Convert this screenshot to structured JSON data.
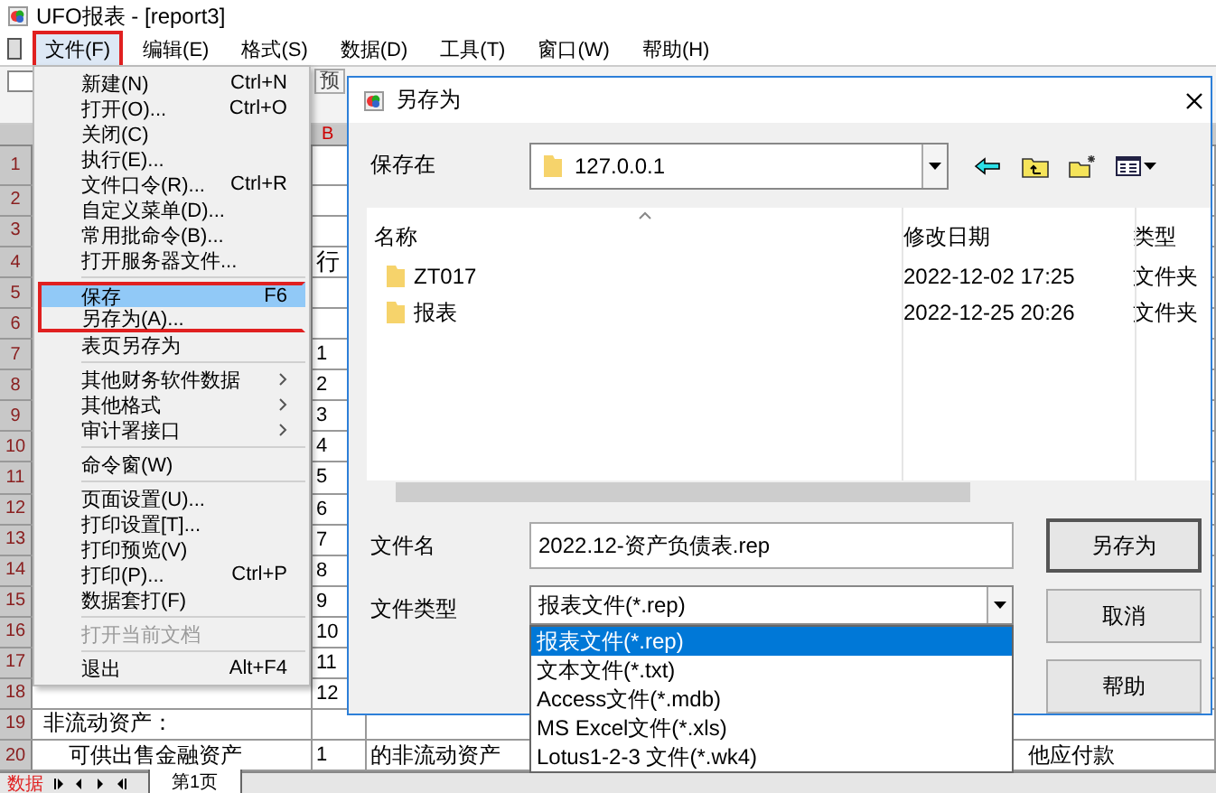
{
  "window": {
    "title": "UFO报表 - [report3]"
  },
  "menu_bar": [
    {
      "label": "文件(F)",
      "selected": true,
      "annotated": true
    },
    {
      "label": "编辑(E)",
      "selected": false,
      "annotated": false
    },
    {
      "label": "格式(S)",
      "selected": false,
      "annotated": false
    },
    {
      "label": "数据(D)",
      "selected": false,
      "annotated": false
    },
    {
      "label": "工具(T)",
      "selected": false,
      "annotated": false
    },
    {
      "label": "窗口(W)",
      "selected": false,
      "annotated": false
    },
    {
      "label": "帮助(H)",
      "selected": false,
      "annotated": false
    }
  ],
  "toolbar": {
    "button_text": "预"
  },
  "sheet": {
    "column_header": "B",
    "rows": [
      {
        "num": "1",
        "cells": []
      },
      {
        "num": "2",
        "cells": []
      },
      {
        "num": "3",
        "cells": []
      },
      {
        "num": "4",
        "cells": [
          "",
          "行"
        ]
      },
      {
        "num": "5",
        "cells": []
      },
      {
        "num": "6",
        "cells": []
      },
      {
        "num": "7",
        "cells": [
          "",
          "1"
        ]
      },
      {
        "num": "8",
        "cells": [
          "",
          "2"
        ]
      },
      {
        "num": "9",
        "cells": [
          "",
          "3"
        ]
      },
      {
        "num": "10",
        "cells": [
          "",
          "4"
        ]
      },
      {
        "num": "11",
        "cells": [
          "",
          "5"
        ]
      },
      {
        "num": "12",
        "cells": [
          "",
          "6"
        ]
      },
      {
        "num": "13",
        "cells": [
          "",
          "7"
        ]
      },
      {
        "num": "14",
        "cells": [
          "",
          "8"
        ]
      },
      {
        "num": "15",
        "cells": [
          "",
          "9"
        ]
      },
      {
        "num": "16",
        "cells": [
          "",
          "10"
        ]
      },
      {
        "num": "17",
        "cells": [
          "",
          "11"
        ]
      },
      {
        "num": "18",
        "cells": [
          "",
          "12"
        ]
      },
      {
        "num": "19",
        "cells": [
          "非流动资产："
        ]
      },
      {
        "num": "20",
        "cells": [
          "可供出售金融资产",
          "1",
          "的非流动资产",
          "他应付款"
        ]
      }
    ],
    "mode": "数据",
    "sheet_tab": "第1页"
  },
  "file_menu": [
    {
      "kind": "item",
      "label": "新建(N)",
      "shortcut": "Ctrl+N",
      "selected": false,
      "disabled": false,
      "annotated": false
    },
    {
      "kind": "item",
      "label": "打开(O)...",
      "shortcut": "Ctrl+O",
      "selected": false,
      "disabled": false,
      "annotated": false
    },
    {
      "kind": "item",
      "label": "关闭(C)",
      "selected": false,
      "disabled": false,
      "annotated": false
    },
    {
      "kind": "item",
      "label": "执行(E)...",
      "selected": false,
      "disabled": false,
      "annotated": false
    },
    {
      "kind": "item",
      "label": "文件口令(R)...",
      "shortcut": "Ctrl+R",
      "selected": false,
      "disabled": false,
      "annotated": false
    },
    {
      "kind": "item",
      "label": "自定义菜单(D)...",
      "selected": false,
      "disabled": false,
      "annotated": false
    },
    {
      "kind": "item",
      "label": "常用批命令(B)...",
      "selected": false,
      "disabled": false,
      "annotated": false
    },
    {
      "kind": "item",
      "label": "打开服务器文件...",
      "selected": false,
      "disabled": false,
      "annotated": false
    },
    {
      "kind": "separator"
    },
    {
      "kind": "item",
      "label": "保存",
      "shortcut": "F6",
      "selected": true,
      "disabled": false,
      "annotated": true
    },
    {
      "kind": "item",
      "label": "另存为(A)...",
      "selected": false,
      "disabled": false,
      "annotated": true
    },
    {
      "kind": "item",
      "label": "表页另存为",
      "selected": false,
      "disabled": false,
      "annotated": false
    },
    {
      "kind": "separator"
    },
    {
      "kind": "submenu",
      "label": "其他财务软件数据",
      "selected": false,
      "disabled": false,
      "annotated": false
    },
    {
      "kind": "submenu",
      "label": "其他格式",
      "selected": false,
      "disabled": false,
      "annotated": false
    },
    {
      "kind": "submenu",
      "label": "审计署接口",
      "selected": false,
      "disabled": false,
      "annotated": false
    },
    {
      "kind": "separator"
    },
    {
      "kind": "item",
      "label": "命令窗(W)",
      "selected": false,
      "disabled": false,
      "annotated": false
    },
    {
      "kind": "separator"
    },
    {
      "kind": "item",
      "label": "页面设置(U)...",
      "selected": false,
      "disabled": false,
      "annotated": false
    },
    {
      "kind": "item",
      "label": "打印设置[T]...",
      "selected": false,
      "disabled": false,
      "annotated": false
    },
    {
      "kind": "item",
      "label": "打印预览(V)",
      "selected": false,
      "disabled": false,
      "annotated": false
    },
    {
      "kind": "item",
      "label": "打印(P)...",
      "shortcut": "Ctrl+P",
      "selected": false,
      "disabled": false,
      "annotated": false
    },
    {
      "kind": "item",
      "label": "数据套打(F)",
      "selected": false,
      "disabled": false,
      "annotated": false
    },
    {
      "kind": "separator"
    },
    {
      "kind": "item",
      "label": "打开当前文档",
      "selected": false,
      "disabled": true,
      "annotated": false
    },
    {
      "kind": "separator"
    },
    {
      "kind": "item",
      "label": "退出",
      "shortcut": "Alt+F4",
      "selected": false,
      "disabled": false,
      "annotated": false
    }
  ],
  "dialog": {
    "title": "另存为",
    "save_in_label": "保存在",
    "save_in": "127.0.0.1",
    "columns": [
      "名称",
      "修改日期",
      "类型"
    ],
    "files": [
      {
        "name": "ZT017",
        "modified": "2022-12-02 17:25",
        "type": "文件夹"
      },
      {
        "name": "报表",
        "modified": "2022-12-25 20:26",
        "type": "文件夹"
      }
    ],
    "filename_label": "文件名",
    "filename": "2022.12-资产负债表.rep",
    "filetype_label": "文件类型",
    "filetype": "报表文件(*.rep)",
    "filetype_options": [
      {
        "label": "报表文件(*.rep)",
        "selected": true
      },
      {
        "label": "文本文件(*.txt)",
        "selected": false
      },
      {
        "label": "Access文件(*.mdb)",
        "selected": false
      },
      {
        "label": "MS Excel文件(*.xls)",
        "selected": false
      },
      {
        "label": "Lotus1-2-3 文件(*.wk4)",
        "selected": false
      }
    ],
    "buttons": [
      "另存为",
      "取消",
      "帮助"
    ]
  }
}
